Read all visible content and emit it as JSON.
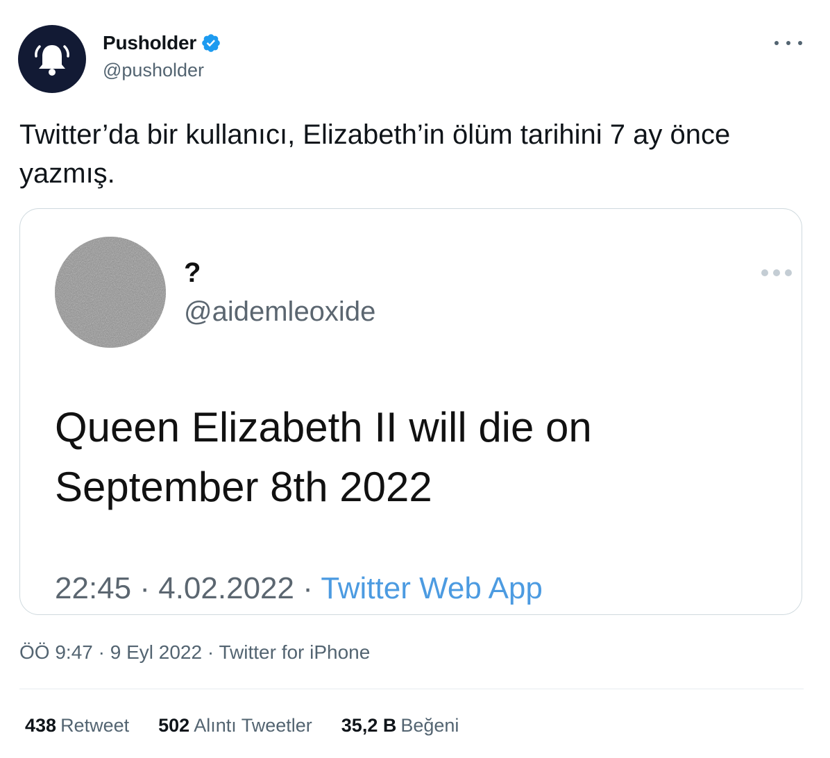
{
  "author": {
    "name": "Pusholder",
    "handle": "@pusholder",
    "avatar_icon": "bell-icon",
    "verified": true
  },
  "tweet": {
    "text": "Twitter’da bir kullanıcı, Elizabeth’in ölüm tarihini 7 ay önce yazmış.",
    "time": "ÖÖ 9:47",
    "date": "9 Eyl 2022",
    "source": "Twitter for iPhone",
    "separator": "·"
  },
  "embed": {
    "name": "?",
    "handle": "@aidemleoxide",
    "text": "Queen Elizabeth II will die on September 8th 2022",
    "time": "22:45",
    "date": "4.02.2022",
    "source": "Twitter Web App",
    "separator": "·"
  },
  "stats": {
    "retweets": {
      "count": "438",
      "label": "Retweet"
    },
    "quotes": {
      "count": "502",
      "label": "Alıntı Tweetler"
    },
    "likes": {
      "count": "35,2 B",
      "label": "Beğeni"
    }
  },
  "colors": {
    "avatar_bg": "#121a34",
    "verified": "#1d9bf0",
    "link": "#4c9be1",
    "muted": "#536471"
  }
}
